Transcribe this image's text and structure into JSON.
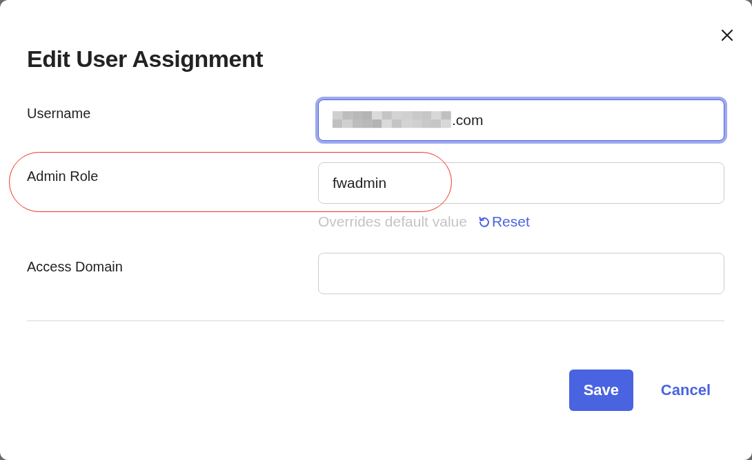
{
  "dialog": {
    "title": "Edit User Assignment"
  },
  "fields": [
    {
      "label": "Username",
      "value": ".com",
      "redacted": true,
      "focused": true,
      "highlighted": false
    },
    {
      "label": "Admin Role",
      "value": "fwadmin",
      "redacted": false,
      "focused": false,
      "highlighted": true,
      "hint": "Overrides default value",
      "reset": "Reset"
    },
    {
      "label": "Access Domain",
      "redacted": false,
      "focused": false,
      "highlighted": false
    }
  ],
  "buttons": [
    {
      "label": "Save",
      "kind": "primary"
    },
    {
      "label": "Cancel",
      "kind": "link"
    }
  ]
}
